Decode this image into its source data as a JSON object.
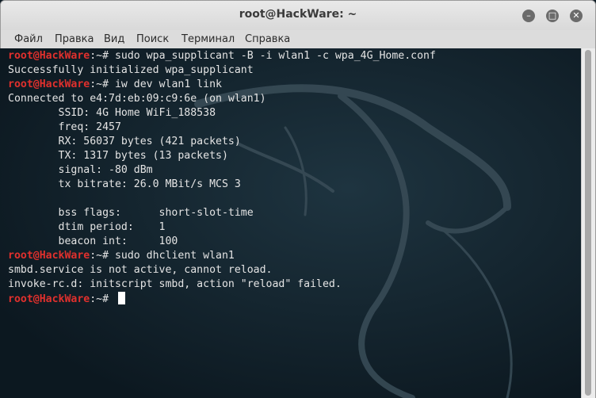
{
  "window": {
    "title": "root@HackWare: ~"
  },
  "controls": {
    "minimize": "–",
    "maximize": "□",
    "close": "✕"
  },
  "menu": [
    "Файл",
    "Правка",
    "Вид",
    "Поиск",
    "Терминал",
    "Справка"
  ],
  "terminal": {
    "prompt_user": "root@HackWare",
    "prompt_path": ":~#",
    "lines": [
      {
        "type": "cmd",
        "text": " sudo wpa_supplicant -B -i wlan1 -c wpa_4G_Home.conf"
      },
      {
        "type": "out",
        "text": "Successfully initialized wpa_supplicant"
      },
      {
        "type": "cmd",
        "text": " iw dev wlan1 link"
      },
      {
        "type": "out",
        "text": "Connected to e4:7d:eb:09:c9:6e (on wlan1)"
      },
      {
        "type": "out",
        "text": "        SSID: 4G Home WiFi_188538"
      },
      {
        "type": "out",
        "text": "        freq: 2457"
      },
      {
        "type": "out",
        "text": "        RX: 56037 bytes (421 packets)"
      },
      {
        "type": "out",
        "text": "        TX: 1317 bytes (13 packets)"
      },
      {
        "type": "out",
        "text": "        signal: -80 dBm"
      },
      {
        "type": "out",
        "text": "        tx bitrate: 26.0 MBit/s MCS 3"
      },
      {
        "type": "out",
        "text": ""
      },
      {
        "type": "out",
        "text": "        bss flags:      short-slot-time"
      },
      {
        "type": "out",
        "text": "        dtim period:    1"
      },
      {
        "type": "out",
        "text": "        beacon int:     100"
      },
      {
        "type": "cmd",
        "text": " sudo dhclient wlan1"
      },
      {
        "type": "out",
        "text": "smbd.service is not active, cannot reload."
      },
      {
        "type": "out",
        "text": "invoke-rc.d: initscript smbd, action \"reload\" failed."
      },
      {
        "type": "cmd",
        "text": " ",
        "cursor": true
      }
    ]
  },
  "colors": {
    "prompt": "#e0302d",
    "text": "#e4e4e4",
    "background": "#101d26"
  }
}
